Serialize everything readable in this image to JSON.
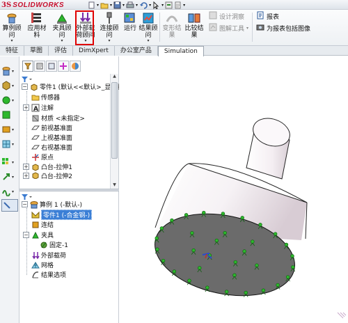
{
  "app": {
    "logo_ds": "3S",
    "logo_name": "SOLIDWORKS"
  },
  "ribbon": {
    "study": {
      "label": "算例顾\n问",
      "icon": "study-advisor-icon"
    },
    "material": {
      "label": "应用材\n料",
      "icon": "apply-material-icon"
    },
    "fixtures": {
      "label": "夹具顾\n问",
      "icon": "fixtures-advisor-icon"
    },
    "loads": {
      "label": "外部载\n荷顾问",
      "icon": "external-loads-advisor-icon"
    },
    "connections": {
      "label": "连接顾\n问",
      "icon": "connections-advisor-icon"
    },
    "run": {
      "label": "运行",
      "icon": "run-icon"
    },
    "results": {
      "label": "结果顾\n问",
      "icon": "results-advisor-icon"
    },
    "deformed": {
      "label": "变形结\n果",
      "icon": "deformed-result-icon"
    },
    "compare": {
      "label": "比较结\n果",
      "icon": "compare-results-icon"
    },
    "design_insight": "设计洞察",
    "plot_tools": "图解工具",
    "report": "报表",
    "include_image": "为报表包括图像"
  },
  "tabs": [
    "特征",
    "草图",
    "评估",
    "DimXpert",
    "办公室产品",
    "Simulation"
  ],
  "active_tab": "Simulation",
  "feature_tree": [
    {
      "label": "零件1 (默认<<默认>_显示状",
      "icon": "part-icon",
      "expand": "minus"
    },
    {
      "label": "传感器",
      "icon": "sensor-icon"
    },
    {
      "label": "注解",
      "icon": "annotation-icon",
      "expand": "plus"
    },
    {
      "label": "材质 <未指定>",
      "icon": "material-icon"
    },
    {
      "label": "前视基准面",
      "icon": "plane-icon"
    },
    {
      "label": "上视基准面",
      "icon": "plane-icon"
    },
    {
      "label": "右视基准面",
      "icon": "plane-icon"
    },
    {
      "label": "原点",
      "icon": "origin-icon"
    },
    {
      "label": "凸台-拉伸1",
      "icon": "boss-extrude-icon",
      "expand": "plus"
    },
    {
      "label": "凸台-拉伸2",
      "icon": "boss-extrude-icon",
      "expand": "plus"
    }
  ],
  "sim_tree": [
    {
      "label": "算例 1 (-默认-)",
      "icon": "study-icon",
      "expand": "minus"
    },
    {
      "label": "零件1 (-合金钢-)",
      "icon": "part-icon",
      "selected": true
    },
    {
      "label": "连结",
      "icon": "connections-icon"
    },
    {
      "label": "夹具",
      "icon": "fixture-icon",
      "expand": "minus"
    },
    {
      "label": "固定-1",
      "icon": "fixed-geometry-icon"
    },
    {
      "label": "外部载荷",
      "icon": "external-loads-icon"
    },
    {
      "label": "网格",
      "icon": "mesh-icon"
    },
    {
      "label": "结果选项",
      "icon": "result-options-icon"
    }
  ],
  "colors": {
    "highlight_box": "#e00000",
    "selection": "#3b7fd6",
    "fixture_marker": "#2db82d",
    "bottom_face": "#6b6b6b"
  }
}
